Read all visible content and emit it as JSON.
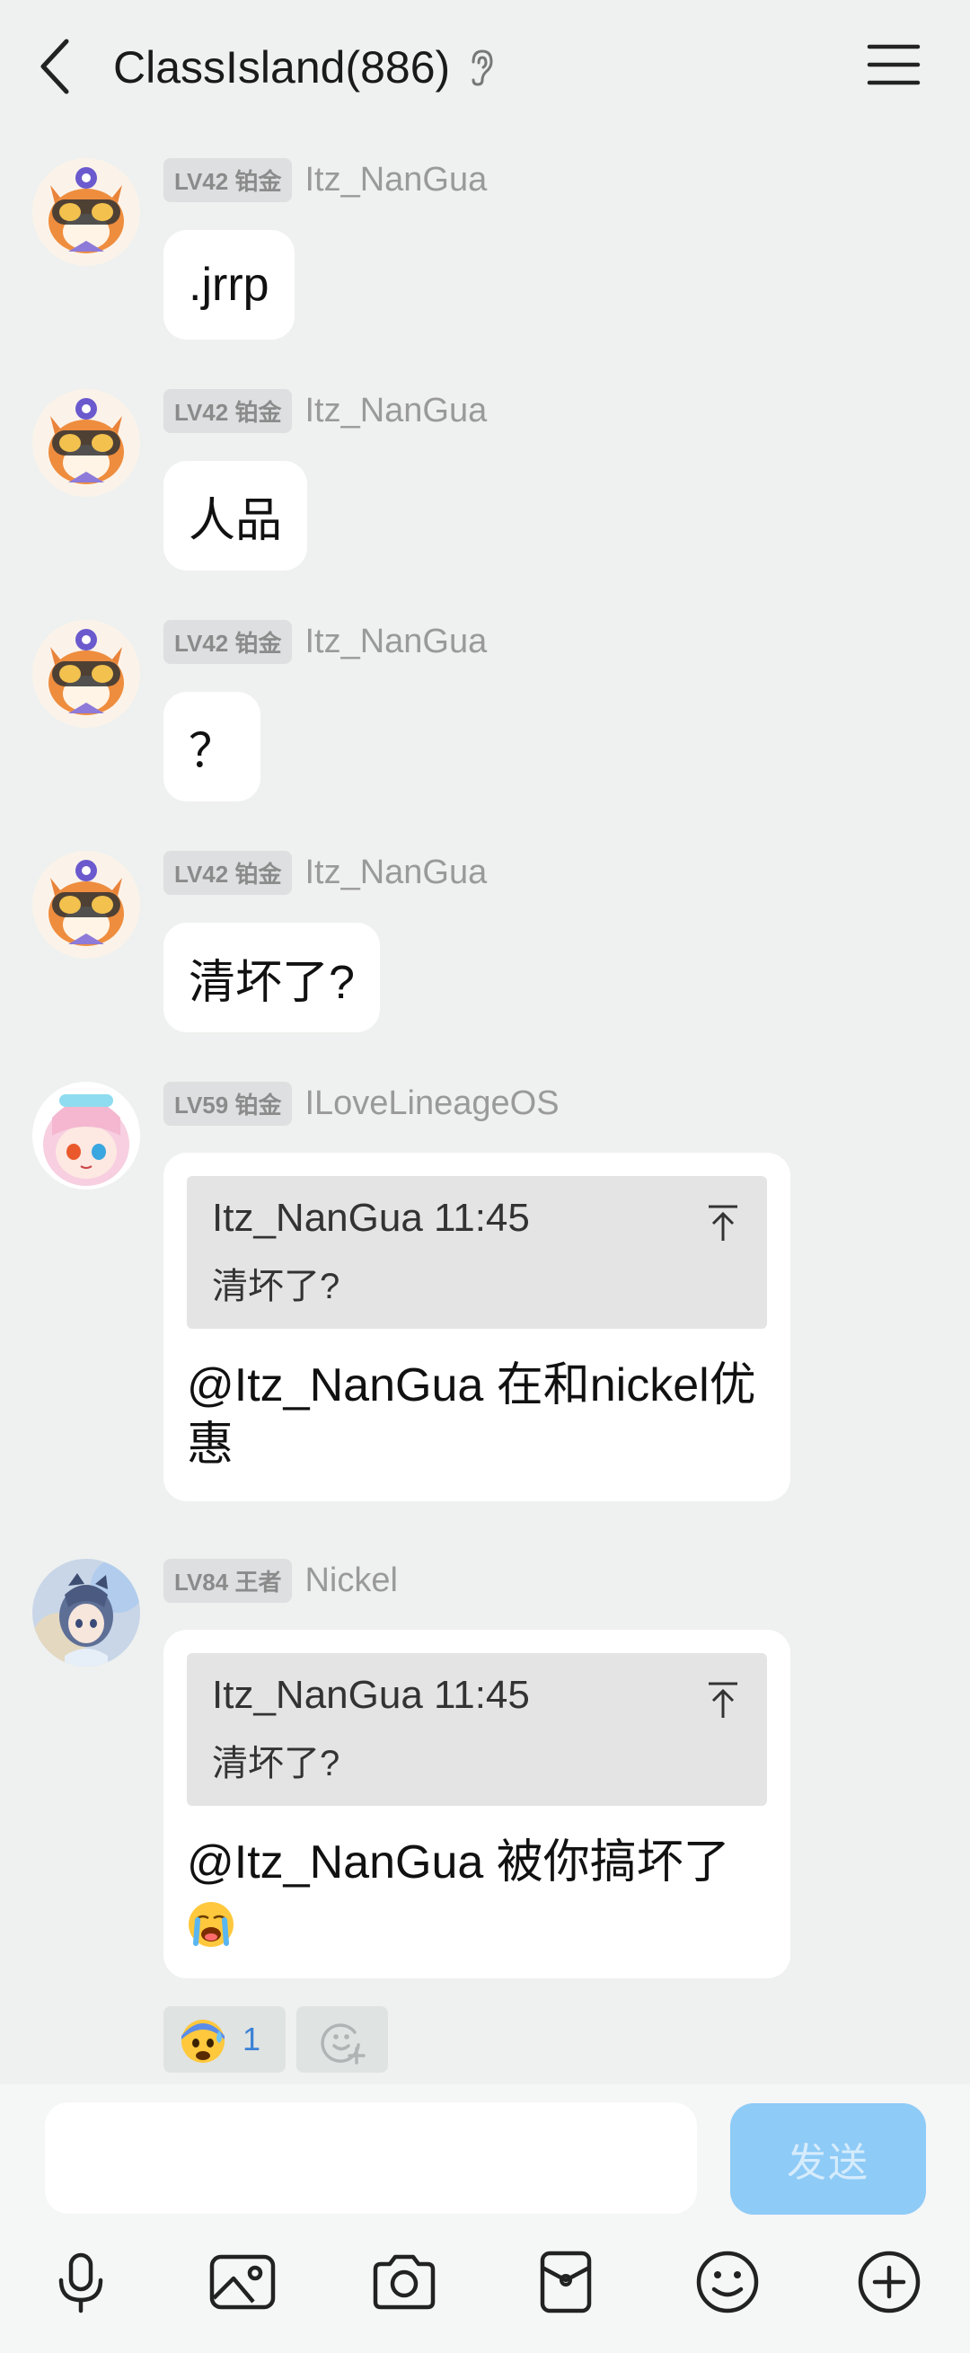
{
  "header": {
    "title": "ClassIsland(886)",
    "back_icon": "chevron-left-icon",
    "ear_icon": "ear-icon",
    "menu_icon": "menu-icon"
  },
  "messages": [
    {
      "level": "LV42 铂金",
      "sender": "Itz_NanGua",
      "text": ".jrrp"
    },
    {
      "level": "LV42 铂金",
      "sender": "Itz_NanGua",
      "text": "人品"
    },
    {
      "level": "LV42 铂金",
      "sender": "Itz_NanGua",
      "text": "？"
    },
    {
      "level": "LV42 铂金",
      "sender": "Itz_NanGua",
      "text": "清坏了?"
    },
    {
      "level": "LV59 铂金",
      "sender": "ILoveLineageOS",
      "quote": {
        "head": "Itz_NanGua 11:45",
        "text": "清坏了?"
      },
      "text": "@Itz_NanGua 在和nickel优惠"
    },
    {
      "level": "LV84 王者",
      "sender": "Nickel",
      "quote": {
        "head": "Itz_NanGua 11:45",
        "text": "清坏了?"
      },
      "text": "@Itz_NanGua 被你搞坏了",
      "text_emoji": "loudly-crying-face-emoji"
    }
  ],
  "reactions": [
    {
      "emoji": "anxious-face-with-sweat-emoji",
      "count": "1"
    },
    {
      "emoji": "add-reaction-icon"
    }
  ],
  "composer": {
    "input_value": "",
    "send_label": "发送",
    "send_color": "#8ecbf7",
    "tools": [
      "microphone-icon",
      "image-icon",
      "camera-icon",
      "red-packet-icon",
      "emoji-icon",
      "plus-icon"
    ]
  },
  "colors": {
    "background": "#eef1ef",
    "bubble": "#ffffff",
    "badge": "#dedfe0",
    "accent_blue": "#3b82d6"
  }
}
